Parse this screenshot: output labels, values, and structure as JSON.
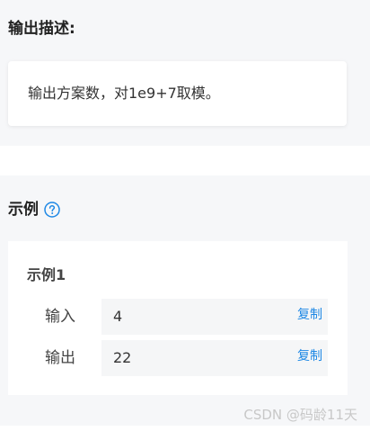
{
  "output_section": {
    "heading": "输出描述:",
    "description": "输出方案数，对1e9+7取模。"
  },
  "example_section": {
    "heading": "示例",
    "help_icon": "question-circle-icon",
    "accent_color": "#1e88e5",
    "example": {
      "name": "示例1",
      "input_label": "输入",
      "input_value": "4",
      "output_label": "输出",
      "output_value": "22",
      "copy_label": "复制"
    }
  },
  "watermark": "CSDN @码龄11天"
}
